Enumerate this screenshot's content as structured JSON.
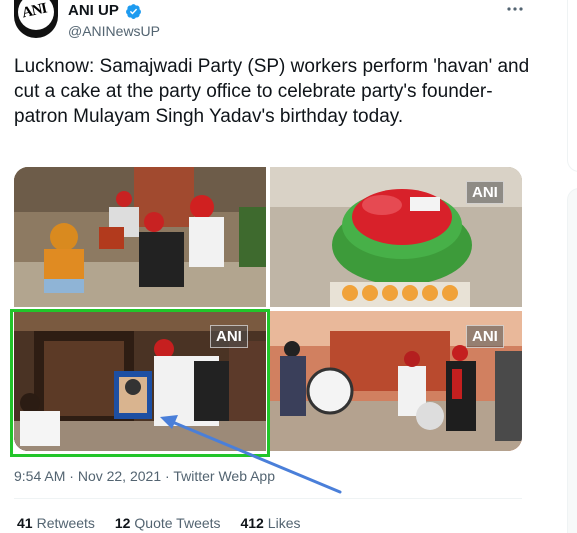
{
  "author": {
    "display_name": "ANI UP",
    "handle": "@ANINewsUP",
    "avatar_text": "ANI",
    "verified_icon": "verified-badge-icon",
    "verified_color": "#1d9bf0"
  },
  "more_icon": "more-options-icon",
  "tweet": {
    "text": "Lucknow: Samajwadi Party (SP) workers perform 'havan' and cut a cake at the party office to celebrate party's founder-patron Mulayam Singh Yadav's birthday today."
  },
  "media": {
    "watermark": "ANI",
    "highlight_color": "#22c52a",
    "arrow_color": "#4a7fd9"
  },
  "meta": {
    "time": "9:54 AM",
    "separator": " · ",
    "date": "Nov 22, 2021",
    "source": "Twitter Web App"
  },
  "stats": {
    "retweets_count": "41",
    "retweets_label": "Retweets",
    "quotes_count": "12",
    "quotes_label": "Quote Tweets",
    "likes_count": "412",
    "likes_label": "Likes"
  }
}
